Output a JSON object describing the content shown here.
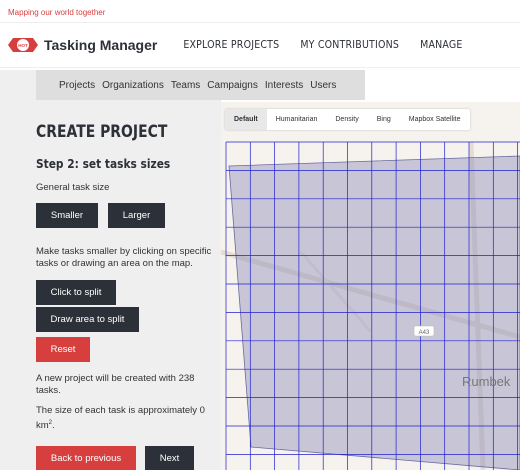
{
  "header": {
    "tagline": "Mapping our world together",
    "app_title": "Tasking Manager",
    "logo_badge_text": "HOT",
    "nav": [
      "EXPLORE PROJECTS",
      "MY CONTRIBUTIONS",
      "MANAGE"
    ]
  },
  "submenu": [
    "Projects",
    "Organizations",
    "Teams",
    "Campaigns",
    "Interests",
    "Users"
  ],
  "form": {
    "title": "CREATE PROJECT",
    "step": "Step 2: set tasks sizes",
    "general_size_label": "General task size",
    "smaller_label": "Smaller",
    "larger_label": "Larger",
    "instructions": "Make tasks smaller by clicking on specific tasks or drawing an area on the map.",
    "click_split_label": "Click to split",
    "draw_split_label": "Draw area to split",
    "reset_label": "Reset",
    "project_info": "A new project will be created with 238 tasks.",
    "size_info": "The size of each task is approximately 0 km",
    "size_info_sup": "2",
    "size_info_end": ".",
    "back_label": "Back to previous",
    "next_label": "Next"
  },
  "map": {
    "layers": [
      "Default",
      "Humanitarian",
      "Density",
      "Bing",
      "Mapbox Satellite"
    ],
    "active_layer": "Default",
    "place_label": "Rumbek",
    "road_label": "A43",
    "grid_color": "#2020d0",
    "overlay_color": "#8888b8"
  },
  "colors": {
    "accent": "#d73f3f",
    "dark": "#2c3038"
  }
}
